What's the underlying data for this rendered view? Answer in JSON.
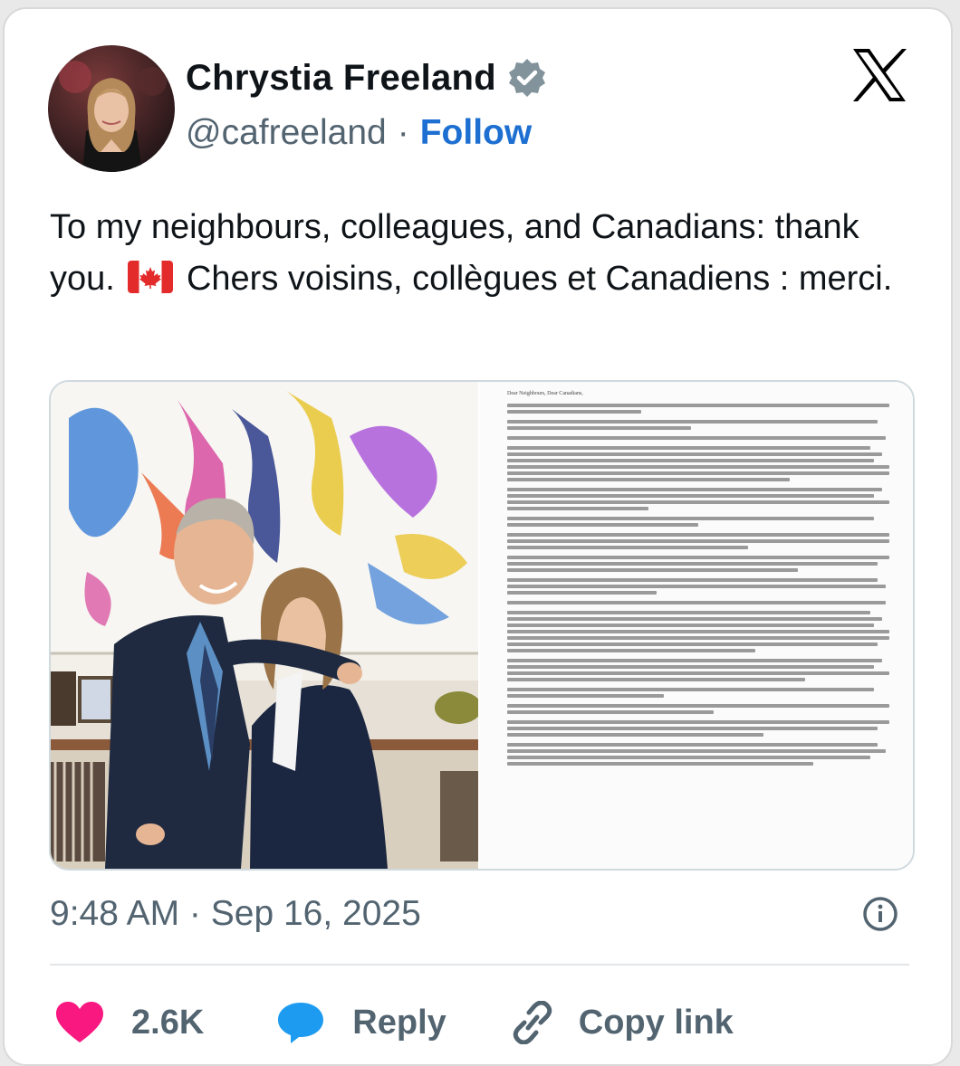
{
  "author": {
    "name": "Chrystia Freeland",
    "handle": "@cafreeland",
    "separator": "·",
    "follow_label": "Follow"
  },
  "post": {
    "text_before_flag": "To my neighbours, colleagues, and Canadians: thank you.",
    "flag_icon": "canada-flag-icon",
    "text_after_flag": "Chers voisins, collègues et Canadiens : merci."
  },
  "media": {
    "letter": {
      "salutation": "Dear Neighbours, Dear Canadians,",
      "paragraph_line_counts": [
        2,
        2,
        1,
        6,
        4,
        2,
        3,
        3,
        3,
        1,
        7,
        4,
        2,
        2,
        3,
        4
      ]
    }
  },
  "meta": {
    "timestamp": "9:48 AM · Sep 16, 2025"
  },
  "actions": {
    "like_count": "2.6K",
    "reply_label": "Reply",
    "copy_label": "Copy link"
  },
  "colors": {
    "like": "#f91880",
    "reply": "#1d9bf0",
    "follow": "#1d6fd1",
    "verified": "#82939c"
  }
}
